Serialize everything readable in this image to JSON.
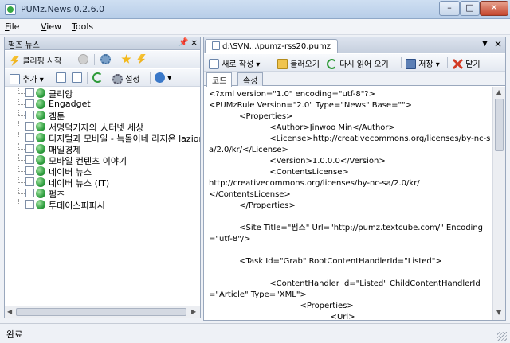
{
  "window": {
    "title": "PUMz.News 0.2.6.0",
    "minimize": "–",
    "maximize": "□",
    "close": "✕"
  },
  "menu": [
    {
      "label": "File",
      "underline": "F",
      "rest": "ile"
    },
    {
      "label": "View",
      "underline": "V",
      "rest": "iew"
    },
    {
      "label": "Tools",
      "underline": "T",
      "rest": "ools"
    }
  ],
  "left_panel": {
    "title": "펌즈 뉴스",
    "pin": "ᵖ",
    "close": "×",
    "toolbar1": {
      "start_clipping": "클리핑 시작"
    },
    "toolbar2": {
      "add": "추가",
      "settings": "설정"
    },
    "feeds": [
      "클리앙",
      "Engadget",
      "겜툰",
      "서명덕기자의 人터넷 세상",
      "디지털과 모바일 - 늑돌이네 라지온 lazion.com",
      "매일경제",
      "모바일 컨텐츠 이야기",
      "네이버 뉴스",
      "네이버 뉴스 (IT)",
      "펌즈",
      "투데이스피피시"
    ]
  },
  "document": {
    "tab_title": "d:\\SVN...\\pumz-rss20.pumz",
    "toolbar": {
      "new": "새로 작성",
      "open": "불러오기",
      "reload": "다시 읽어 오기",
      "save": "저장",
      "close": "닫기"
    },
    "view_tabs": {
      "code": "코드",
      "properties": "속성"
    },
    "code_lines": [
      "<?xml version=\"1.0\" encoding=\"utf-8\"?>",
      "<PUMzRule Version=\"2.0\" Type=\"News\" Base=\"\">",
      "            <Properties>",
      "                        <Author>Jinwoo Min</Author>",
      "                        <License>http://creativecommons.org/licenses/by-nc-sa/2.0/kr/</License>",
      "                        <Version>1.0.0.0</Version>",
      "                        <ContentsLicense>",
      "http://creativecommons.org/licenses/by-nc-sa/2.0/kr/",
      "</ContentsLicense>",
      "            </Properties>",
      "",
      "            <Site Title=\"펌즈\" Url=\"http://pumz.textcube.com/\" Encoding=\"utf-8\"/>",
      "",
      "            <Task Id=\"Grab\" RootContentHandlerId=\"Listed\">",
      "",
      "                        <ContentHandler Id=\"Listed\" ChildContentHandlerId=\"Article\" Type=\"XML\">",
      "                                    <Properties>",
      "                                                <Url>"
    ]
  },
  "status": {
    "text": "완료"
  }
}
